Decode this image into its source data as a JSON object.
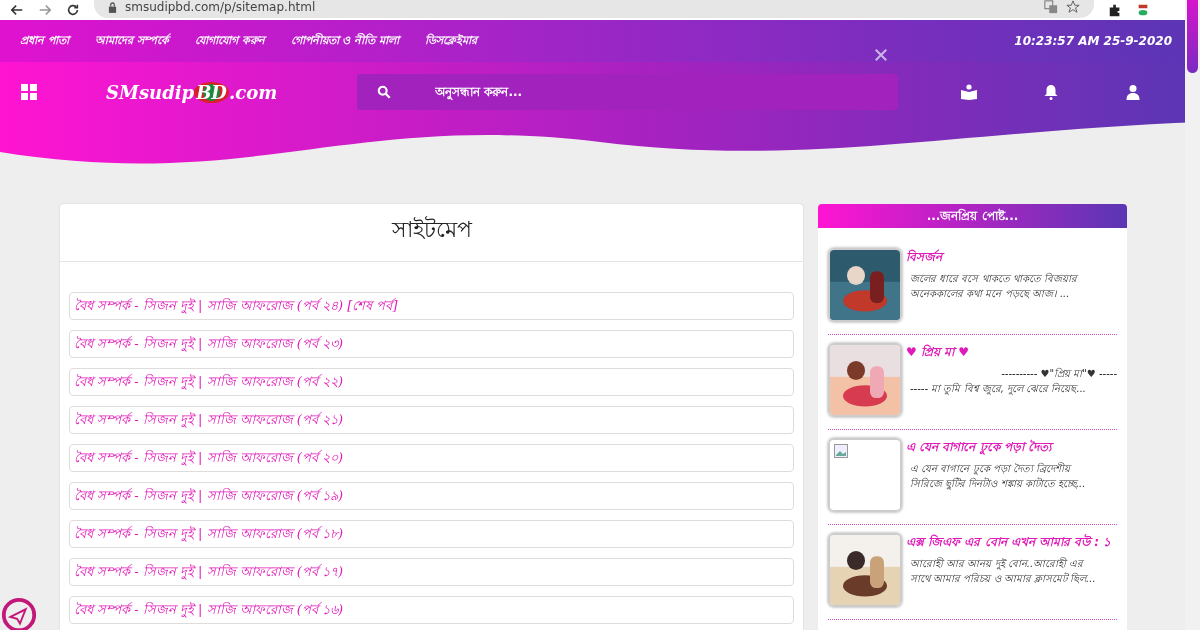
{
  "browser": {
    "url": "smsudipbd.com/p/sitemap.html"
  },
  "top_nav": {
    "links": [
      "প্রধান পাতা",
      "আমাদের সম্পর্কে",
      "যোগাযোগ করুন",
      "গোপনীয়তা ও নীতি মালা",
      "ডিসক্লেইমার"
    ],
    "datetime": "10:23:57 AM 25-9-2020"
  },
  "header": {
    "logo": {
      "prefix": "SMsudip",
      "badge": "BD",
      "suffix": ".com"
    },
    "search": {
      "placeholder": "অনুসন্ধান করুন..."
    }
  },
  "sitemap": {
    "title": "সাইটমেপ",
    "links": [
      "বৈধ সম্পর্ক - সিজন দুই | সাজি আফরোজ (পর্ব ২৪) [শেষ পর্ব]",
      "বৈধ সম্পর্ক - সিজন দুই | সাজি আফরোজ (পর্ব ২৩)",
      "বৈধ সম্পর্ক - সিজন দুই | সাজি আফরোজ (পর্ব ২২)",
      "বৈধ সম্পর্ক - সিজন দুই | সাজি আফরোজ (পর্ব ২১)",
      "বৈধ সম্পর্ক - সিজন দুই | সাজি আফরোজ (পর্ব ২০)",
      "বৈধ সম্পর্ক - সিজন দুই | সাজি আফরোজ (পর্ব ১৯)",
      "বৈধ সম্পর্ক - সিজন দুই | সাজি আফরোজ (পর্ব ১৮)",
      "বৈধ সম্পর্ক - সিজন দুই | সাজি আফরোজ (পর্ব ১৭)",
      "বৈধ সম্পর্ক - সিজন দুই | সাজি আফরোজ (পর্ব ১৬)"
    ]
  },
  "popular": {
    "title": "...জনপ্রিয় পোষ্ট...",
    "posts": [
      {
        "title": "বিসর্জন",
        "excerpt": [
          "জলের ধারে বসে থাকতে থাকতে বিজয়ার",
          "অনেককালের কথা মনে পড়ছে আজ। ..."
        ]
      },
      {
        "title": "♥ প্রিয় মা ♥",
        "excerpt": [
          "---------- ♥\"প্রিয় মা\"♥ -----",
          "----- মা তুমি বিশ্ব জুরে, দুলে ঝেরে নিয়েছ..."
        ]
      },
      {
        "title": "এ যেন বাগানে ঢুকে পড়া দৈত্য",
        "excerpt": [
          "এ যেন বাগানে ঢুকে পড়া দৈত্য ব্রিদেশীয়",
          "সিরিজে ছুটির দিনটাও শঙ্কায় কাটাতে হচ্ছে..."
        ],
        "thumbnail": {
          "kind": "broken"
        }
      },
      {
        "title": "এক্স জিএফ এর বোন এখন আমার বউ : ১",
        "excerpt": [
          "আরোহী আর আনয় দুই বোন..আরোহী এর",
          "সাথে আমার পরিচয় ও আমার ক্লাসমেট ছিল..."
        ]
      }
    ]
  }
}
